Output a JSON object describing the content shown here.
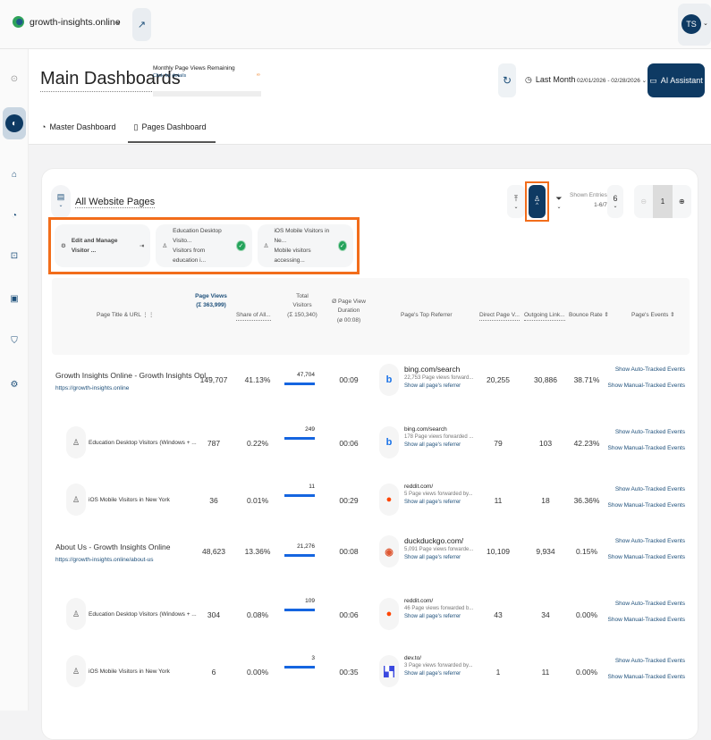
{
  "topbar": {
    "site": "growth-insights.online",
    "user_initials": "TS"
  },
  "sidebar": {
    "icons": [
      "back-icon",
      "dashboard-icon",
      "bag-icon",
      "funnel-icon",
      "focus-icon",
      "chat-icon",
      "shield-check-icon",
      "gear-icon"
    ]
  },
  "header": {
    "title": "Main Dashboards",
    "quota_label": "Monthly Page Views Remaining",
    "quota_link": "Click for details",
    "quota_value": "∞",
    "period": "Last Month",
    "date_range": "02/01/2026 - 02/28/2026",
    "ai_button": "AI Assistant",
    "tabs": [
      {
        "label": "Master Dashboard"
      },
      {
        "label": "Pages Dashboard",
        "selected": true
      }
    ]
  },
  "card": {
    "title": "All Website Pages",
    "shown_label": "Shown Entries",
    "shown_value": "1-6/7",
    "per_page": "6",
    "page": "1",
    "segments": [
      {
        "title": "Edit and Manage Visitor ...",
        "sub": ""
      },
      {
        "title": "Education Desktop Visito...",
        "sub": "Visitors from education i..."
      },
      {
        "title": "iOS Mobile Visitors in Ne...",
        "sub": "Mobile visitors accessing..."
      }
    ]
  },
  "columns": {
    "title": "Page Title & URL",
    "views": "Page Views",
    "views_sum": "(Σ 363,999)",
    "share": "Share of All...",
    "visitors": "Total Visitors",
    "visitors_sum": "(Σ 150,340)",
    "duration": "Ø Page View Duration",
    "duration_avg": "(ø 00:08)",
    "referrer": "Page's Top Referrer",
    "direct": "Direct Page V...",
    "outgoing": "Outgoing Link...",
    "bounce": "Bounce Rate",
    "events": "Page's Events"
  },
  "events": {
    "auto": "Show Auto-Tracked Events",
    "manual": "Show Manual-Tracked Events"
  },
  "rows": [
    {
      "type": "page",
      "title": "Growth Insights Online - Growth Insights Onl...",
      "url": "https://growth-insights.online",
      "views": "149,707",
      "share": "41.13%",
      "visitors": "47,704",
      "duration": "00:09",
      "ref_icon": "bing",
      "ref_domain": "bing.com/search",
      "ref_sub": "22,753 Page views forward...",
      "ref_link": "Show all page's referrer",
      "direct": "20,255",
      "outgoing": "30,886",
      "bounce": "38.71%"
    },
    {
      "type": "segment",
      "title": "Education Desktop Visitors (Windows + ...",
      "views": "787",
      "share": "0.22%",
      "visitors": "249",
      "duration": "00:06",
      "ref_icon": "bing",
      "ref_domain": "bing.com/search",
      "ref_sub": "178 Page views forwarded ...",
      "ref_link": "Show all page's referrer",
      "direct": "79",
      "outgoing": "103",
      "bounce": "42.23%"
    },
    {
      "type": "segment",
      "title": "iOS Mobile Visitors in New York",
      "views": "36",
      "share": "0.01%",
      "visitors": "11",
      "duration": "00:29",
      "ref_icon": "reddit",
      "ref_domain": "reddit.com/",
      "ref_sub": "5 Page views forwarded by...",
      "ref_link": "Show all page's referrer",
      "direct": "11",
      "outgoing": "18",
      "bounce": "36.36%"
    },
    {
      "type": "page",
      "title": "About Us - Growth Insights Online",
      "url": "https://growth-insights.online/about-us",
      "views": "48,623",
      "share": "13.36%",
      "visitors": "21,276",
      "duration": "00:08",
      "ref_icon": "duckduckgo",
      "ref_domain": "duckduckgo.com/",
      "ref_sub": "5,091 Page views forwarde...",
      "ref_link": "Show all page's referrer",
      "direct": "10,109",
      "outgoing": "9,934",
      "bounce": "0.15%"
    },
    {
      "type": "segment",
      "title": "Education Desktop Visitors (Windows + ...",
      "views": "304",
      "share": "0.08%",
      "visitors": "109",
      "duration": "00:06",
      "ref_icon": "reddit",
      "ref_domain": "reddit.com/",
      "ref_sub": "46 Page views forwarded b...",
      "ref_link": "Show all page's referrer",
      "direct": "43",
      "outgoing": "34",
      "bounce": "0.00%"
    },
    {
      "type": "segment",
      "title": "iOS Mobile Visitors in New York",
      "views": "6",
      "share": "0.00%",
      "visitors": "3",
      "duration": "00:35",
      "ref_icon": "devto",
      "ref_domain": "dev.to/",
      "ref_sub": "3 Page views forwarded by...",
      "ref_link": "Show all page's referrer",
      "direct": "1",
      "outgoing": "11",
      "bounce": "0.00%"
    }
  ],
  "colors": {
    "accent": "#0e3a63",
    "highlight": "#f26d1b",
    "bar": "#1565e0",
    "success": "#23a35a"
  }
}
